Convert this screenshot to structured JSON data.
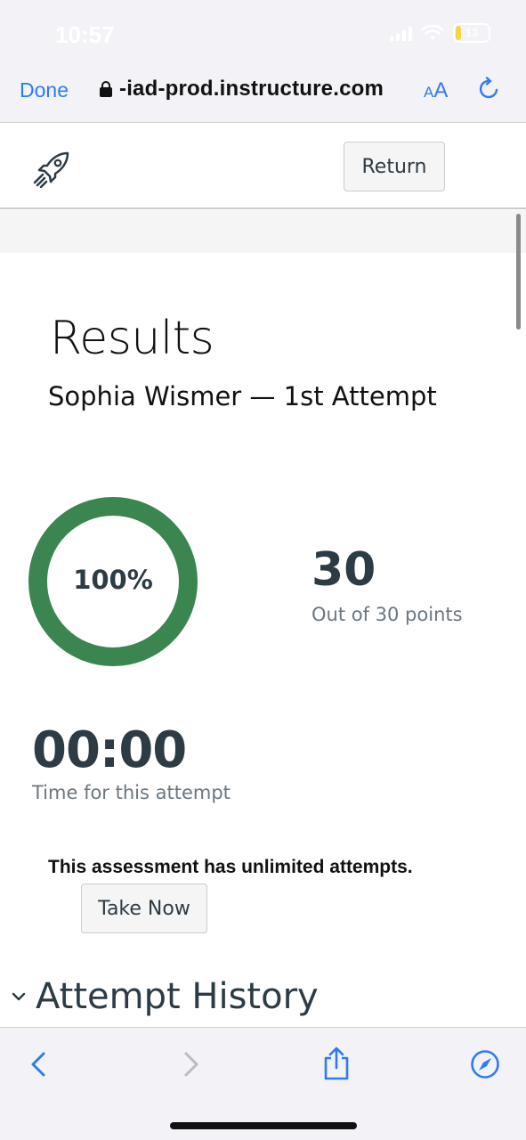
{
  "status": {
    "time": "10:57",
    "battery": "13"
  },
  "browser": {
    "done_label": "Done",
    "url": "-iad-prod.instructure.com",
    "text_size_small": "A",
    "text_size_large": "A",
    "icons": [
      "lock-icon",
      "reload-icon"
    ]
  },
  "header": {
    "return_label": "Return",
    "logo_icon": "rocket-icon"
  },
  "results": {
    "title": "Results",
    "subtitle": "Sophia Wismer — 1st Attempt",
    "percent_label": "100%",
    "percent_value": 100,
    "score": "30",
    "score_label": "Out of 30 points",
    "time": "00:00",
    "time_label": "Time for this attempt",
    "attempts_note": "This assessment has unlimited attempts.",
    "take_now_label": "Take Now",
    "history_title": "Attempt History"
  },
  "colors": {
    "accent": "#2f7bf5",
    "donut": "#3b8551",
    "text_dark": "#2d3b45",
    "text_muted": "#6b7780"
  },
  "toolbar": {
    "icons": [
      "back-icon",
      "forward-icon",
      "share-icon",
      "compass-icon"
    ]
  }
}
